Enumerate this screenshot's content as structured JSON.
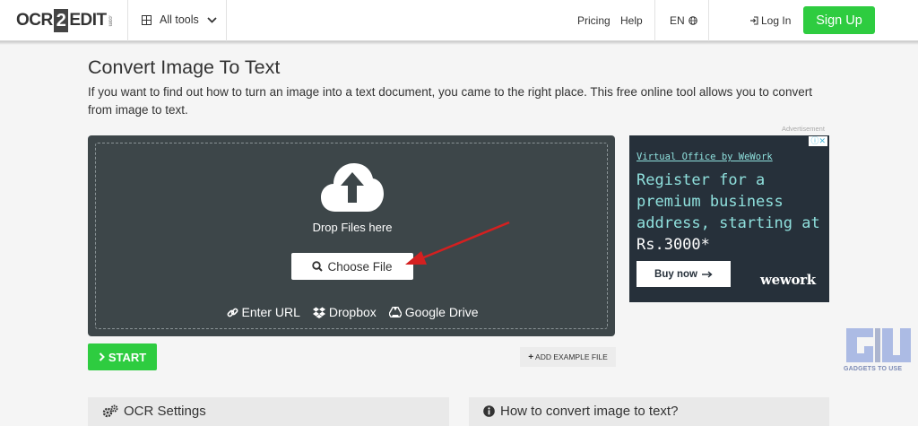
{
  "header": {
    "logo_ocr": "OCR",
    "logo_two": "2",
    "logo_edit": "EDIT",
    "logo_com": ".com",
    "all_tools": "All tools",
    "pricing": "Pricing",
    "help": "Help",
    "language": "EN",
    "login": "Log In",
    "signup": "Sign Up"
  },
  "page": {
    "title": "Convert Image To Text",
    "description": "If you want to find out how to turn an image into a text document, you came to the right place. This free online tool allows you to convert from image to text."
  },
  "upload": {
    "drop_text": "Drop Files here",
    "choose_file": "Choose File",
    "enter_url": "Enter URL",
    "dropbox": "Dropbox",
    "google_drive": "Google Drive"
  },
  "actions": {
    "start": "START",
    "add_example": "ADD EXAMPLE FILE"
  },
  "ad": {
    "label": "Advertisement",
    "brand": "Virtual Office by WeWork",
    "headline": "Register for a premium business address, starting at",
    "price": "Rs.3000*",
    "cta": "Buy now",
    "logo": "wework"
  },
  "watermark": {
    "text": "GADGETS TO USE"
  },
  "panels": {
    "ocr_settings": "OCR Settings",
    "how_to": "How to convert image to text?"
  },
  "colors": {
    "accent_green": "#2ecc40",
    "upload_bg": "#3d4649",
    "ad_bg": "#26303a",
    "ad_text": "#8fe0dd",
    "annotation_arrow": "#d42020"
  },
  "icons": {
    "all_tools": "grid-icon",
    "language": "globe-icon",
    "login": "sign-in-icon",
    "upload": "cloud-upload-icon",
    "choose_file": "search-icon",
    "enter_url": "link-icon",
    "dropbox": "dropbox-icon",
    "google_drive": "google-drive-icon",
    "start": "chevron-right-icon",
    "add_example": "plus-icon",
    "ocr_settings": "gears-icon",
    "how_to": "info-circle-icon"
  }
}
